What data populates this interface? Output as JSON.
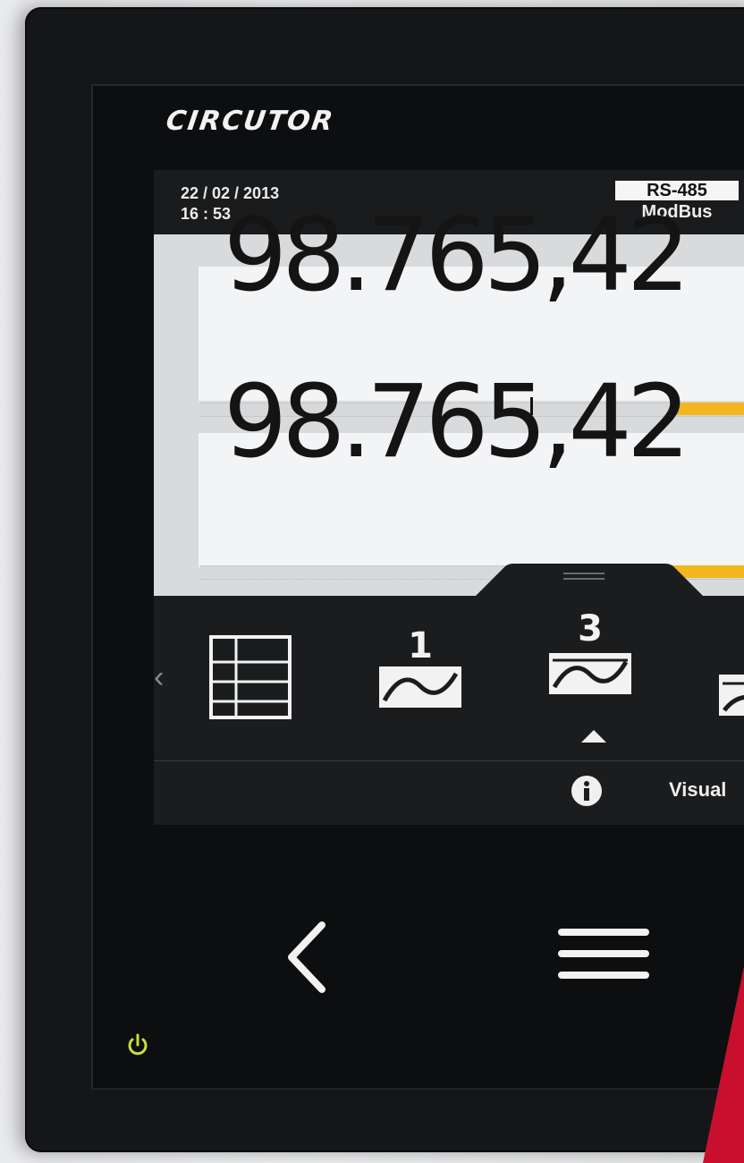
{
  "device": {
    "brand": "CIRCUTOR"
  },
  "status_bar": {
    "date": "22 / 02 / 2013",
    "time": "16 : 53",
    "comm_protocol_top": "RS-485",
    "comm_protocol_bottom": "ModBus"
  },
  "readings": [
    {
      "value": "98.765,42"
    },
    {
      "value": "98.765,42"
    }
  ],
  "menu": {
    "items": [
      {
        "icon": "table-view-icon"
      },
      {
        "icon": "waveform-1-icon",
        "label": "1"
      },
      {
        "icon": "waveform-3-icon",
        "label": "3",
        "selected": true
      },
      {
        "icon": "waveform-partial-icon"
      }
    ]
  },
  "info_bar": {
    "icon": "info-icon",
    "text": "Visual"
  },
  "hardware_buttons": {
    "back": "back-chevron-icon",
    "menu": "menu-hamburger-icon",
    "power": "power-icon"
  },
  "colors": {
    "accent_bar": "#f2b71e",
    "power_led": "#c8dd3a",
    "brand_stripe": "#c8102e"
  }
}
